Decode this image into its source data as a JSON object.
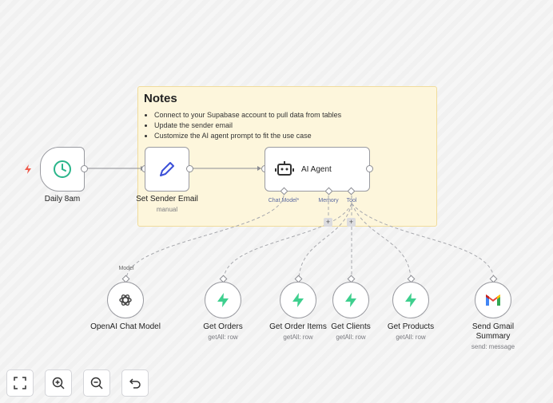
{
  "sticky": {
    "title": "Notes",
    "items": [
      "Connect to your Supabase account to pull data from tables",
      "Update the sender email",
      "Customize the AI agent prompt to fit the use case"
    ]
  },
  "nodes": {
    "trigger": {
      "label": "Daily 8am"
    },
    "set_sender": {
      "label": "Set Sender Email",
      "sub": "manual"
    },
    "agent": {
      "label": "AI Agent"
    },
    "chat_model": {
      "label": "OpenAI Chat Model"
    },
    "get_orders": {
      "label": "Get Orders",
      "sub": "getAll: row"
    },
    "get_order_items": {
      "label": "Get Order Items",
      "sub": "getAll: row"
    },
    "get_clients": {
      "label": "Get Clients",
      "sub": "getAll: row"
    },
    "get_products": {
      "label": "Get Products",
      "sub": "getAll: row"
    },
    "send_gmail": {
      "label": "Send Gmail",
      "label2": "Summary",
      "sub": "send: message"
    }
  },
  "ports": {
    "chat_model": "Chat Model*",
    "memory": "Memory",
    "tool": "Tool",
    "model": "Model"
  },
  "buttons": {
    "plus": "+"
  },
  "colors": {
    "supabase": "#3ecf8e",
    "clock": "#2ab58a",
    "pen": "#3b4fd8",
    "trigger_bolt": "#ef5a4b",
    "sticky_bg": "#fdf6dc"
  },
  "toolbar": [
    "fullscreen-icon",
    "zoom-in-icon",
    "zoom-out-icon",
    "undo-icon"
  ]
}
